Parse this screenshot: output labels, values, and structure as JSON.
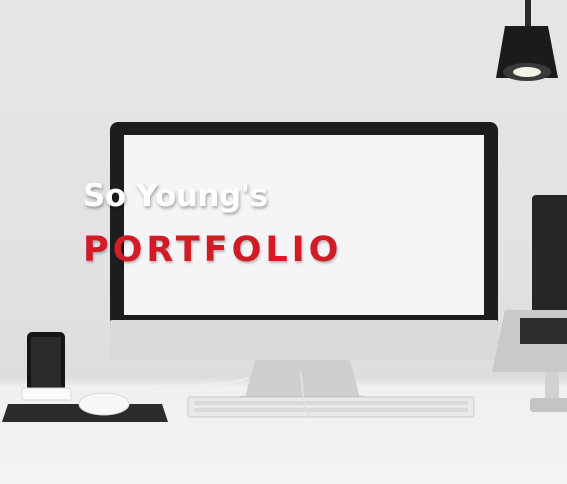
{
  "hero": {
    "greeting": "So Young's",
    "title": "PORTFOLIO"
  },
  "colors": {
    "title_red": "#d11c26",
    "greeting_white": "#ffffff",
    "wall": "#e5e4e5",
    "desk": "#f3f2f2"
  },
  "icons": [
    "desk-lamp-icon",
    "imac-icon",
    "laptop-icon",
    "phone-dock-icon",
    "mouse-icon",
    "keyboard-icon"
  ]
}
